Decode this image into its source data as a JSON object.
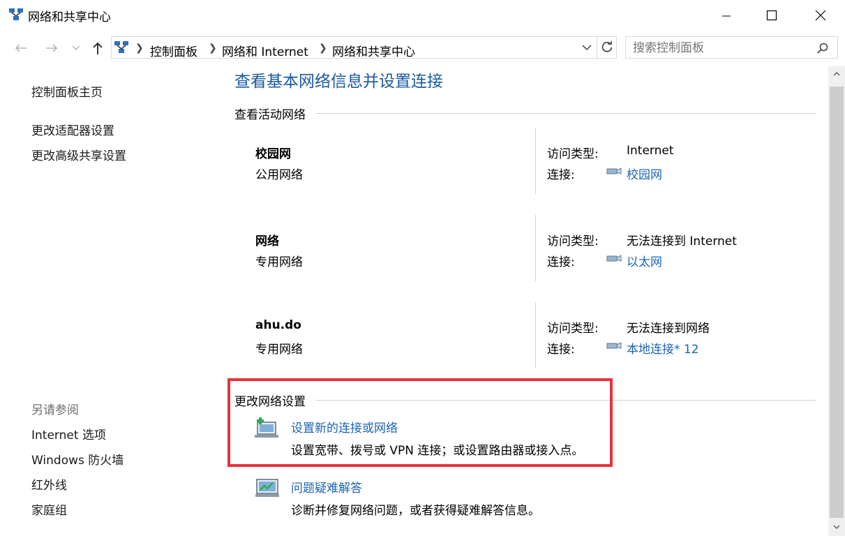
{
  "window": {
    "title": "网络和共享中心"
  },
  "address": {
    "crumbs": [
      "控制面板",
      "网络和 Internet",
      "网络和共享中心"
    ]
  },
  "search": {
    "placeholder": "搜索控制面板"
  },
  "sidebar": {
    "home": "控制面板主页",
    "items": [
      "更改适配器设置",
      "更改高级共享设置"
    ],
    "see_also_title": "另请参阅",
    "see_also": [
      "Internet 选项",
      "Windows 防火墙",
      "红外线",
      "家庭组"
    ]
  },
  "main": {
    "title": "查看基本网络信息并设置连接",
    "active_section": "查看活动网络",
    "access_label": "访问类型:",
    "conn_label": "连接:",
    "networks": [
      {
        "name": "校园网",
        "type": "公用网络",
        "access": "Internet",
        "connection": "校园网"
      },
      {
        "name": "网络",
        "type": "专用网络",
        "access": "无法连接到 Internet",
        "connection": "以太网"
      },
      {
        "name": "ahu.do",
        "type": "专用网络",
        "access": "无法连接到网络",
        "connection": "本地连接* 12"
      }
    ],
    "change_section": "更改网络设置",
    "tasks": [
      {
        "title": "设置新的连接或网络",
        "desc": "设置宽带、拨号或 VPN 连接；或设置路由器或接入点。"
      },
      {
        "title": "问题疑难解答",
        "desc": "诊断并修复网络问题，或者获得疑难解答信息。"
      }
    ]
  },
  "colors": {
    "link": "#1a64b4",
    "title": "#1a5aa0",
    "highlight": "#e8323c"
  }
}
